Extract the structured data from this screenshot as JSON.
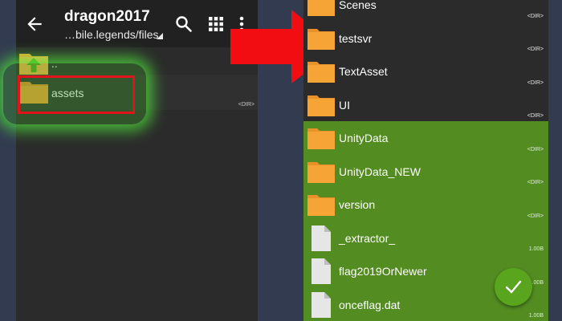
{
  "left_panel": {
    "header": {
      "title": "dragon2017",
      "subtitle": "…bile.legends/files",
      "icons": [
        "back-arrow-icon",
        "search-icon",
        "grid-view-icon",
        "more-vert-icon"
      ]
    },
    "items": [
      {
        "name": "..",
        "meta": "",
        "icon": "folder-up-icon"
      },
      {
        "name": "assets",
        "meta": "<DIR>",
        "icon": "folder-icon"
      }
    ]
  },
  "right_panel": {
    "items": [
      {
        "name": "Scenes",
        "meta": "<DIR>",
        "type": "folder",
        "selected": false
      },
      {
        "name": "testsvr",
        "meta": "<DIR>",
        "type": "folder",
        "selected": false
      },
      {
        "name": "TextAsset",
        "meta": "<DIR>",
        "type": "folder",
        "selected": false
      },
      {
        "name": "UI",
        "meta": "<DIR>",
        "type": "folder",
        "selected": false
      },
      {
        "name": "UnityData",
        "meta": "<DIR>",
        "type": "folder",
        "selected": true
      },
      {
        "name": "UnityData_NEW",
        "meta": "<DIR>",
        "type": "folder",
        "selected": true
      },
      {
        "name": "version",
        "meta": "<DIR>",
        "type": "folder",
        "selected": true
      },
      {
        "name": "_extractor_",
        "meta": "1.00B",
        "type": "file",
        "selected": true
      },
      {
        "name": "flag2019OrNewer",
        "meta": "1.00B",
        "type": "file",
        "selected": true
      },
      {
        "name": "onceflag.dat",
        "meta": "1.00B",
        "type": "file",
        "selected": true
      }
    ]
  },
  "colors": {
    "panel_bg": "#2b2b2b",
    "header_bg": "#212121",
    "selection": "#538d22",
    "folder": "#f7a436",
    "highlight_border": "#e0141a",
    "arrow": "#f10d12",
    "fab": "#59a51e",
    "page_bg": "#323b50"
  },
  "fab": {
    "icon": "check-icon"
  }
}
